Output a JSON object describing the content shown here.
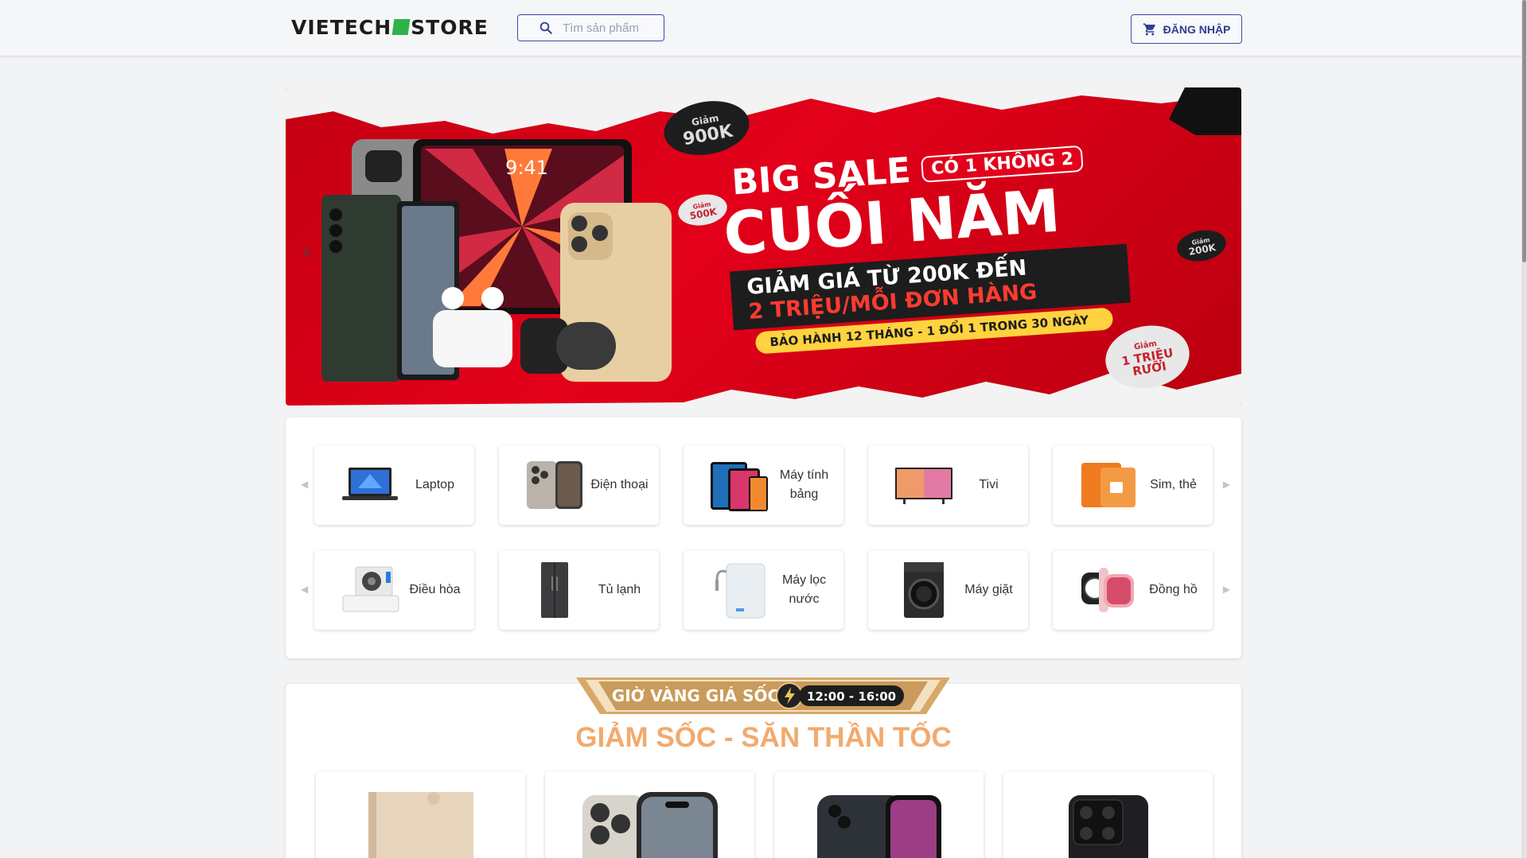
{
  "header": {
    "logo_left": "VIETECH",
    "logo_right": "STORE",
    "search_placeholder": "Tìm sản phẩm",
    "login_label": "ĐĂNG NHẬP"
  },
  "banner": {
    "big_sale": "BIG SALE",
    "badge": "CÓ 1 KHÔNG 2",
    "cuoi_nam": "CUỐI NĂM",
    "line1": "GIẢM GIÁ TỪ 200K ĐẾN",
    "line2": "2 TRIỆU/MỖI ĐƠN HÀNG",
    "warranty": "BẢO HÀNH 12 THÁNG - 1 ĐỔI 1 TRONG 30 NGÀY",
    "coin1_top": "Giảm",
    "coin1_value": "900K",
    "coin2_top": "Giảm",
    "coin2_value": "500K",
    "coin3_top": "Giảm",
    "coin3_value": "200K",
    "coin4_top": "Giảm",
    "coin4_value": "1 TRIỆU RƯỠI",
    "tablet_time": "9:41",
    "prev_arrow": "‹"
  },
  "categories": {
    "row1": [
      {
        "label": "Laptop",
        "icon": "laptop-icon"
      },
      {
        "label": "Điện thoại",
        "icon": "phone-icon"
      },
      {
        "label": "Máy tính bảng",
        "icon": "tablet-icon"
      },
      {
        "label": "Tivi",
        "icon": "tv-icon"
      },
      {
        "label": "Sim, thẻ",
        "icon": "sim-icon"
      }
    ],
    "row2": [
      {
        "label": "Điều hòa",
        "icon": "air-conditioner-icon"
      },
      {
        "label": "Tủ lạnh",
        "icon": "fridge-icon"
      },
      {
        "label": "Máy lọc nước",
        "icon": "water-purifier-icon"
      },
      {
        "label": "Máy giặt",
        "icon": "washing-machine-icon"
      },
      {
        "label": "Đồng hồ",
        "icon": "watch-icon"
      }
    ]
  },
  "flash_sale": {
    "banner_text": "GIỜ VÀNG GIÁ SỐC",
    "time": "12:00 - 16:00",
    "title": "GIẢM SỐC - SĂN THẦN TỐC"
  },
  "colors": {
    "accent": "#2e3e8f",
    "banner_red": "#e3001a",
    "flash_title": "#f2aa6e",
    "logo_green": "#2db34a"
  }
}
